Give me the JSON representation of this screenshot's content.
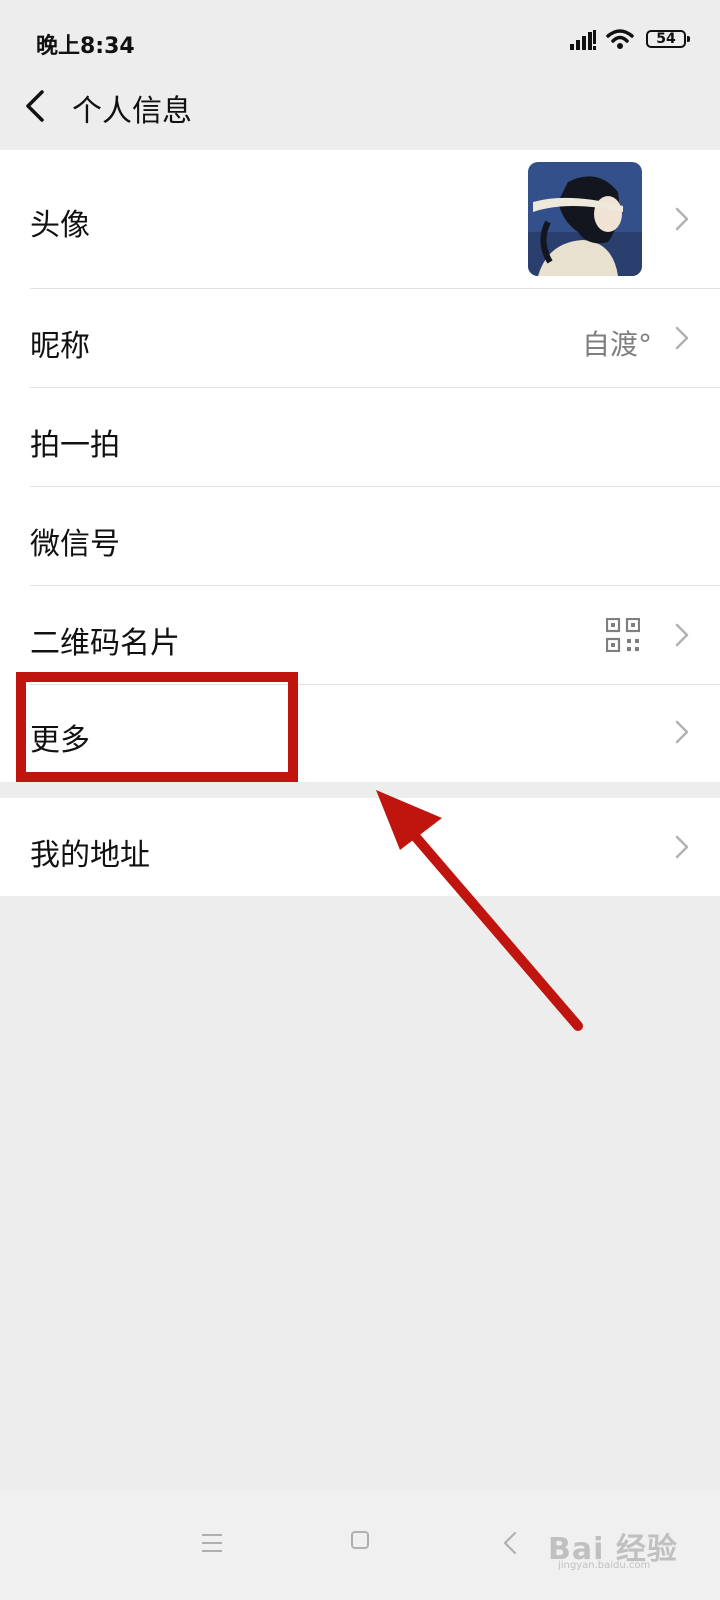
{
  "status_bar": {
    "time": "晚上8:34",
    "battery_level": "54",
    "icons": [
      "signal-icon",
      "wifi-icon",
      "battery-icon"
    ]
  },
  "header": {
    "title": "个人信息",
    "back_icon": "chevron-left-icon"
  },
  "rows": [
    {
      "label": "头像",
      "value": "",
      "accessory": "avatar-image",
      "chevron": true
    },
    {
      "label": "昵称",
      "value": "自渡°",
      "accessory": "",
      "chevron": true
    },
    {
      "label": "拍一拍",
      "value": "",
      "accessory": "",
      "chevron": false
    },
    {
      "label": "微信号",
      "value": "",
      "accessory": "",
      "chevron": false
    },
    {
      "label": "二维码名片",
      "value": "",
      "accessory": "qr-code-icon",
      "chevron": true
    },
    {
      "label": "更多",
      "value": "",
      "accessory": "",
      "chevron": true
    }
  ],
  "rows_second_group": [
    {
      "label": "我的地址",
      "value": "",
      "chevron": true
    }
  ],
  "annotation": {
    "highlight_color": "#c0150f",
    "target": "更多",
    "arrow": "red-arrow-icon"
  },
  "nav_bar": {
    "icons": [
      "menu-icon",
      "home-square-icon",
      "back-triangle-icon"
    ]
  },
  "watermark": {
    "text": "Bai 经验",
    "subtext": "jingyan.baidu.com"
  },
  "colors": {
    "background": "#ededed",
    "list_background": "#ffffff",
    "annotation_red": "#c0150f",
    "secondary_text": "#7f7f7f"
  }
}
